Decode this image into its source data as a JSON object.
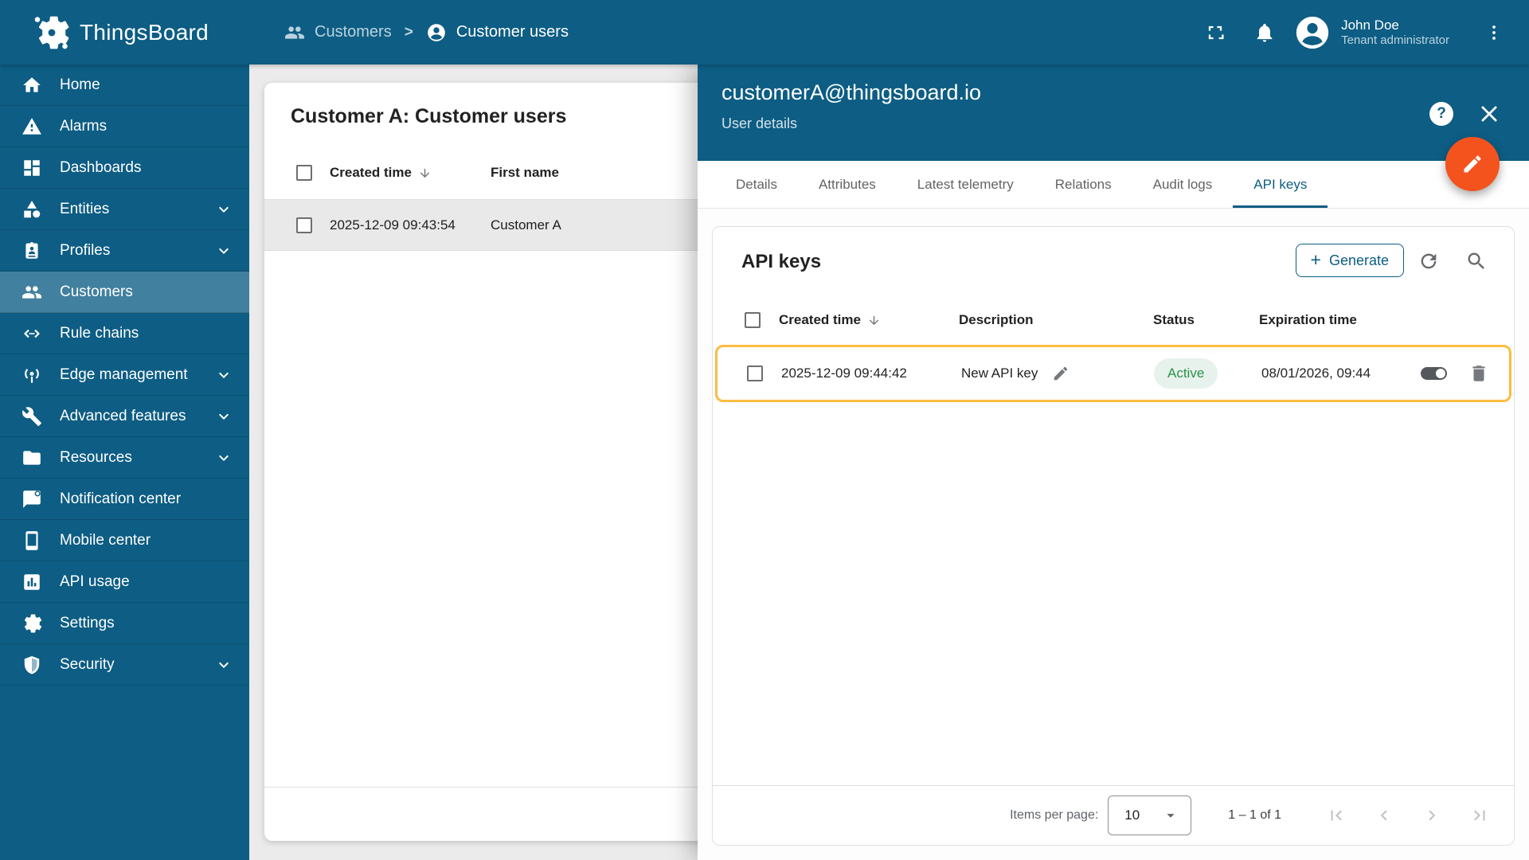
{
  "theme": {
    "primary": "#0d5d84",
    "fab_orange": "#f5531d",
    "row_highlight_border": "#fbbc40",
    "status_active_text": "#27934b",
    "status_active_bg": "#e8f2ec",
    "page_bg": "#ebebeb"
  },
  "header": {
    "app_title": "ThingsBoard",
    "breadcrumb": {
      "separator": ">",
      "items": [
        {
          "label": "Customers",
          "icon": "people-icon"
        },
        {
          "label": "Customer users",
          "icon": "account-circle-icon"
        }
      ]
    },
    "user": {
      "name": "John Doe",
      "role": "Tenant administrator"
    }
  },
  "sidebar": {
    "items": [
      {
        "label": "Home",
        "icon": "home-icon",
        "expandable": false,
        "active": false
      },
      {
        "label": "Alarms",
        "icon": "warning-icon",
        "expandable": false,
        "active": false
      },
      {
        "label": "Dashboards",
        "icon": "dashboards-icon",
        "expandable": false,
        "active": false
      },
      {
        "label": "Entities",
        "icon": "entities-icon",
        "expandable": true,
        "active": false
      },
      {
        "label": "Profiles",
        "icon": "profiles-icon",
        "expandable": true,
        "active": false
      },
      {
        "label": "Customers",
        "icon": "customers-icon",
        "expandable": false,
        "active": true
      },
      {
        "label": "Rule chains",
        "icon": "rule-chains-icon",
        "expandable": false,
        "active": false
      },
      {
        "label": "Edge management",
        "icon": "edge-management-icon",
        "expandable": true,
        "active": false
      },
      {
        "label": "Advanced features",
        "icon": "advanced-features-icon",
        "expandable": true,
        "active": false
      },
      {
        "label": "Resources",
        "icon": "resources-icon",
        "expandable": true,
        "active": false
      },
      {
        "label": "Notification center",
        "icon": "notification-icon",
        "expandable": false,
        "active": false
      },
      {
        "label": "Mobile center",
        "icon": "mobile-icon",
        "expandable": false,
        "active": false
      },
      {
        "label": "API usage",
        "icon": "api-usage-icon",
        "expandable": false,
        "active": false
      },
      {
        "label": "Settings",
        "icon": "settings-icon",
        "expandable": false,
        "active": false
      },
      {
        "label": "Security",
        "icon": "security-icon",
        "expandable": true,
        "active": false
      }
    ]
  },
  "users_panel": {
    "title": "Customer A: Customer users",
    "columns": {
      "created_time": "Created time",
      "first_name": "First name"
    },
    "rows": [
      {
        "created_time": "2025-12-09 09:43:54",
        "first_name": "Customer A",
        "selected": true
      }
    ]
  },
  "drawer": {
    "title": "customerA@thingsboard.io",
    "subtitle": "User details",
    "tabs": [
      {
        "label": "Details",
        "active": false
      },
      {
        "label": "Attributes",
        "active": false
      },
      {
        "label": "Latest telemetry",
        "active": false
      },
      {
        "label": "Relations",
        "active": false
      },
      {
        "label": "Audit logs",
        "active": false
      },
      {
        "label": "API keys",
        "active": true
      }
    ],
    "api_keys": {
      "heading": "API keys",
      "generate_button": "Generate",
      "columns": {
        "created_time": "Created time",
        "description": "Description",
        "status": "Status",
        "expiration_time": "Expiration time"
      },
      "rows": [
        {
          "created_time": "2025-12-09 09:44:42",
          "description": "New API key",
          "status": "Active",
          "expiration_time": "08/01/2026, 09:44",
          "enabled": true,
          "highlighted": true
        }
      ],
      "pagination": {
        "items_per_page_label": "Items per page:",
        "page_size": "10",
        "range_label": "1 – 1 of 1"
      }
    }
  },
  "icons_text": {
    "help": "?",
    "plus": "+"
  }
}
